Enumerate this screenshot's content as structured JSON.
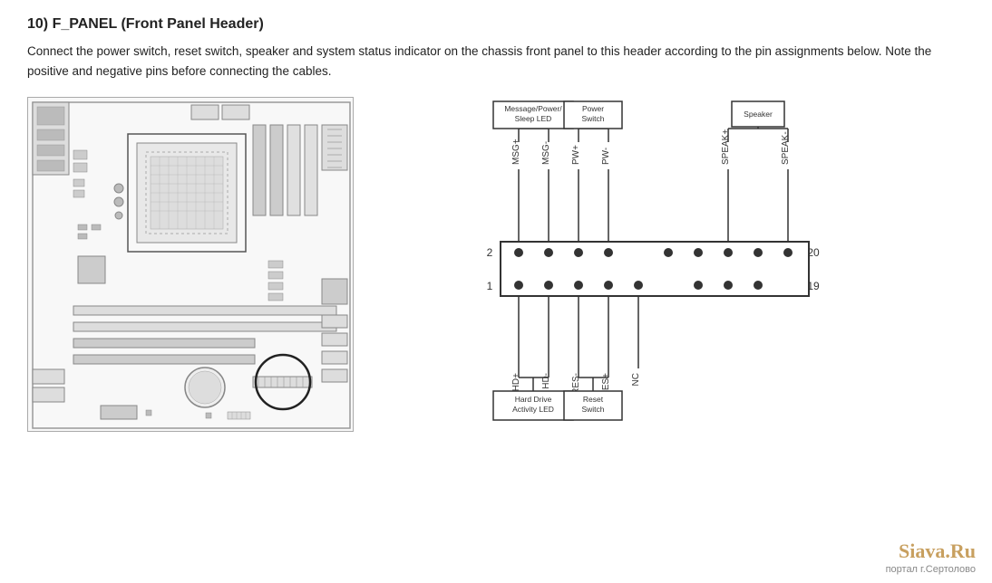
{
  "section": {
    "number": "10)",
    "title": "F_PANEL (Front Panel Header)",
    "description": "Connect the power switch, reset switch, speaker and system status indicator on the chassis front panel to this header according to the pin assignments below. Note the positive and negative pins before connecting the cables."
  },
  "pin_labels": {
    "msg_plus": "MSG+",
    "msg_minus": "MSG-",
    "pw_plus": "PW+",
    "pw_minus": "PW-",
    "speak_plus": "SPEAK+",
    "speak_minus": "SPEAK-",
    "hd_plus": "HD+",
    "hd_minus": "HD-",
    "res_minus": "RES-",
    "res_plus": "RES+",
    "nc": "NC"
  },
  "connectors": {
    "msg_power": "Message/Power/ Sleep LED",
    "power_switch": "Power Switch",
    "speaker": "Speaker",
    "hd_led": "Hard Drive Activity LED",
    "reset_switch": "Reset Switch"
  },
  "pin_numbers": {
    "top_left": "2",
    "bottom_left": "1",
    "top_right": "20",
    "bottom_right": "19"
  },
  "watermark": {
    "brand": "Siava.Ru",
    "subtitle": "портал г.Сертолово"
  }
}
